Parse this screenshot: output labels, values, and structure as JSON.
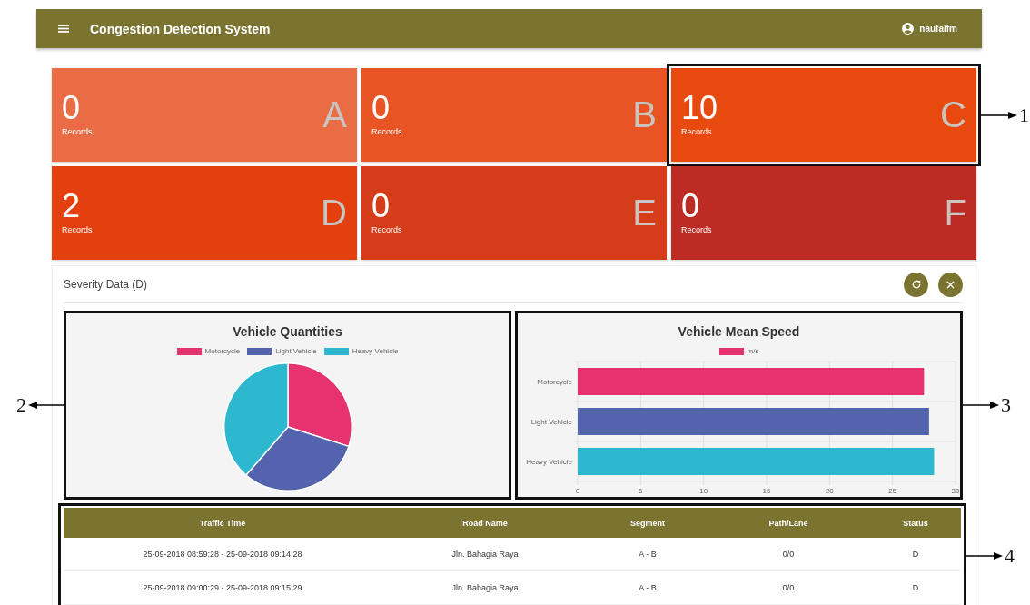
{
  "app_bar": {
    "title": "Congestion Detection System",
    "user": "naufalfm"
  },
  "cards": [
    {
      "count": "0",
      "caption": "Records",
      "letter": "A",
      "color": "#e96c45",
      "highlighted": false
    },
    {
      "count": "0",
      "caption": "Records",
      "letter": "B",
      "color": "#e95424",
      "highlighted": false
    },
    {
      "count": "10",
      "caption": "Records",
      "letter": "C",
      "color": "#e8490e",
      "highlighted": true,
      "callout": "1"
    },
    {
      "count": "2",
      "caption": "Records",
      "letter": "D",
      "color": "#e4400f",
      "highlighted": false
    },
    {
      "count": "0",
      "caption": "Records",
      "letter": "E",
      "color": "#d53d1a",
      "highlighted": false
    },
    {
      "count": "0",
      "caption": "Records",
      "letter": "F",
      "color": "#bc2b24",
      "highlighted": false
    }
  ],
  "panel": {
    "title": "Severity Data (D)",
    "pie": {
      "title": "Vehicle Quantities",
      "callout": "2",
      "legend": [
        {
          "label": "Motorcycle",
          "color": "#e6336f"
        },
        {
          "label": "Light Vehicle",
          "color": "#5463ad"
        },
        {
          "label": "Heavy Vehicle",
          "color": "#2db8d0"
        }
      ]
    },
    "bar": {
      "callout": "3",
      "chart_data": {
        "type": "bar",
        "orientation": "horizontal",
        "title": "Vehicle Mean Speed",
        "categories": [
          "Motorcycle",
          "Light Vehicle",
          "Heavy Vehicle"
        ],
        "series": [
          {
            "color": "#e6336f",
            "values": [
              27.5,
              null,
              null
            ]
          },
          {
            "color": "#5463ad",
            "values": [
              null,
              27.9,
              null
            ]
          },
          {
            "color": "#2db8d0",
            "values": [
              null,
              null,
              28.3
            ]
          }
        ],
        "xlim": [
          0,
          30
        ],
        "xticks": [
          0,
          5,
          10,
          15,
          20,
          25,
          30
        ],
        "grid": true
      },
      "legend": [
        {
          "label": "m/s",
          "color": "#e6336f"
        }
      ]
    },
    "table": {
      "callout": "4",
      "columns": [
        "Traffic Time",
        "Road Name",
        "Segment",
        "Path/Lane",
        "Status"
      ],
      "rows": [
        [
          "25-09-2018 08:59:28 - 25-09-2018 09:14:28",
          "Jln. Bahagia Raya",
          "A - B",
          "0/0",
          "D"
        ],
        [
          "25-09-2018 09:00:29 - 25-09-2018 09:15:29",
          "Jln. Bahagia Raya",
          "A - B",
          "0/0",
          "D"
        ]
      ]
    }
  }
}
